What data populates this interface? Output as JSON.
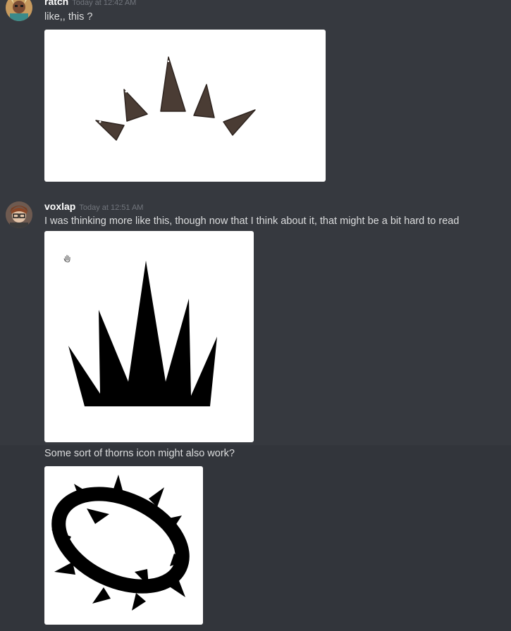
{
  "messages": [
    {
      "username": "ratch",
      "timestamp": "Today at 12:42 AM",
      "text": "like,, this ?",
      "attachment_icon": "crown-spikes-brown-sketch"
    },
    {
      "username": "voxlap",
      "timestamp": "Today at 12:51 AM",
      "text": "I was thinking more like this, though now that I think about it, that might be a bit hard to read",
      "attachment_icon": "crown-spikes-black-silhouette"
    },
    {
      "text": "Some sort of thorns icon might also work?",
      "attachment_icon": "thorn-ring-black"
    }
  ],
  "colors": {
    "background": "#36393f",
    "hover_background": "#32353b",
    "username": "#ffffff",
    "timestamp": "#72767d",
    "message_text": "#dcddde",
    "sketch_brown": "#4a3c34"
  }
}
